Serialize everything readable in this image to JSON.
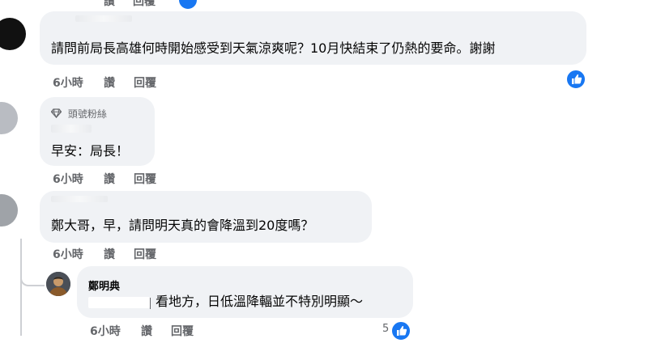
{
  "comments": [
    {
      "text": "請問前局長高雄何時開始感受到天氣涼爽呢？10月快結束了仍熱的要命。謝謝",
      "time": "6小時",
      "like": "讚",
      "reply": "回覆",
      "has_reaction": true
    },
    {
      "badge": "頭號粉絲",
      "text": "早安：局長！",
      "time": "6小時",
      "like": "讚",
      "reply": "回覆"
    },
    {
      "text": "鄭大哥，早，請問明天真的會降溫到20度嗎？",
      "time": "6小時",
      "like": "讚",
      "reply": "回覆"
    }
  ],
  "reply": {
    "author": "鄭明典",
    "text": "看地方，日低溫降輻並不特別明顯～",
    "time": "6小時",
    "like": "讚",
    "reply": "回覆",
    "reaction_count": "5"
  },
  "top_partial": {
    "like": "讚",
    "reply": "回覆"
  },
  "colors": {
    "accent": "#1877f2",
    "bubble": "#f0f2f5",
    "muted": "#65676b"
  }
}
